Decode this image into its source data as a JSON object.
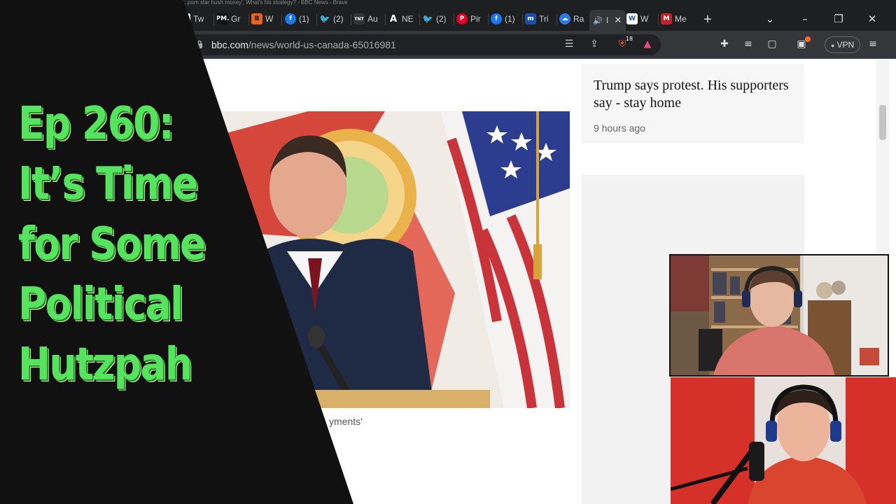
{
  "window": {
    "title_text": "n at, porn star hush money', What's his strategy? - BBC News - Brave"
  },
  "tabs": [
    {
      "label": "Tw",
      "icon": "gp-icon",
      "icon_text": "GP",
      "color": "#ffffff",
      "fg": "#1a1a1a"
    },
    {
      "label": "Gr",
      "icon": "pm-icon",
      "icon_text": "PM.",
      "color": "#111111",
      "fg": "#ffffff"
    },
    {
      "label": "W",
      "icon": "b-icon",
      "icon_text": "B",
      "color": "#e8641c",
      "fg": "#111111"
    },
    {
      "label": "(1)",
      "icon": "facebook-icon",
      "icon_text": "f",
      "color": "#1877f2",
      "fg": "#ffffff"
    },
    {
      "label": "(2)",
      "icon": "twitter-icon",
      "icon_text": "🐦",
      "color": "#1d1f21",
      "fg": "#1d9bf0"
    },
    {
      "label": "Au",
      "icon": "site-icon",
      "icon_text": "TNT",
      "color": "#333333",
      "fg": "#ffffff"
    },
    {
      "label": "NE",
      "icon": "a-icon",
      "icon_text": "A",
      "color": "#1d1f21",
      "fg": "#ffffff"
    },
    {
      "label": "(2)",
      "icon": "twitter-icon",
      "icon_text": "🐦",
      "color": "#1d1f21",
      "fg": "#1d9bf0"
    },
    {
      "label": "Pir",
      "icon": "pinterest-icon",
      "icon_text": "P",
      "color": "#e60023",
      "fg": "#ffffff"
    },
    {
      "label": "(1)",
      "icon": "facebook-icon",
      "icon_text": "f",
      "color": "#1877f2",
      "fg": "#ffffff"
    },
    {
      "label": "Tri",
      "icon": "m-icon",
      "icon_text": "m",
      "color": "#1d4fa8",
      "fg": "#ffffff"
    },
    {
      "label": "Ra",
      "icon": "cloud-icon",
      "icon_text": "☁",
      "color": "#2c7be5",
      "fg": "#ffffff"
    },
    {
      "label": "I",
      "icon": "speaker-icon",
      "icon_text": "🔊",
      "color": "#35363a",
      "fg": "#ffffff",
      "active": true
    },
    {
      "label": "W",
      "icon": "w-icon",
      "icon_text": "W",
      "color": "#ffffff",
      "fg": "#1d4fa8"
    },
    {
      "label": "Me",
      "icon": "badge-icon",
      "icon_text": "M",
      "color": "#c0232b",
      "fg": "#ffffff"
    }
  ],
  "address_bar": {
    "domain": "bbc.com",
    "path": "/news/world-us-canada-65016981"
  },
  "toolbar": {
    "shield_count": "18",
    "vpn_label": "VPN"
  },
  "page": {
    "side_headline": "Trump says protest. His supporters say - stay home",
    "side_time": "9 hours ago",
    "caption_fragment": "yments'"
  },
  "overlay": {
    "title_lines": [
      "Ep 260:",
      "It’s Time",
      "for Some",
      "Political",
      "Hutzpah"
    ]
  },
  "colors": {
    "title_green": "#56e45e",
    "panel_black": "#111111"
  }
}
